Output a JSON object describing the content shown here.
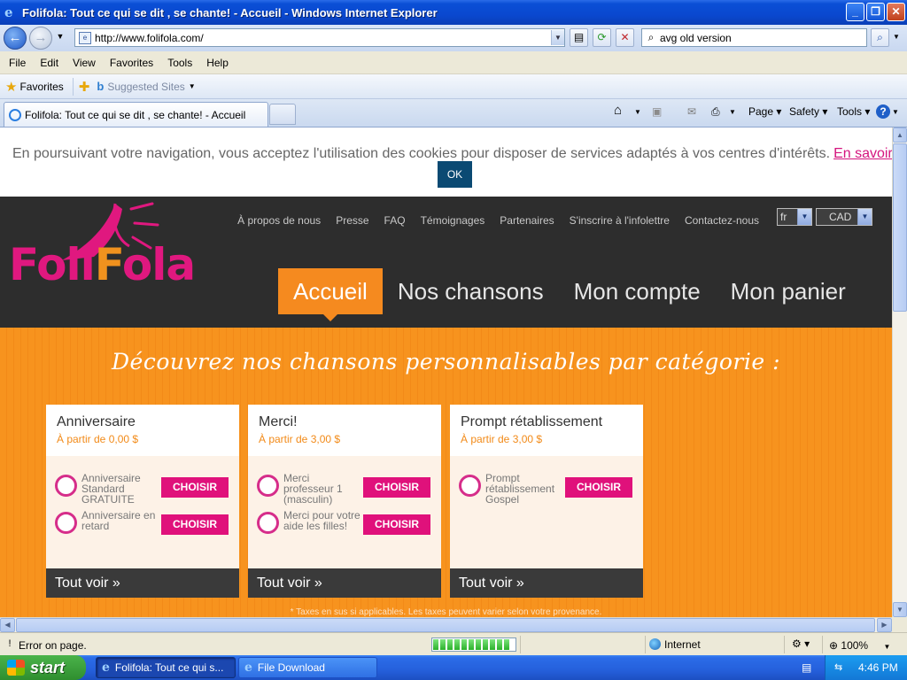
{
  "window": {
    "title": "Folifola: Tout ce qui se dit , se chante! - Accueil - Windows Internet Explorer"
  },
  "browser": {
    "address": "http://www.folifola.com/",
    "search_value": "avg old version",
    "menu": [
      "File",
      "Edit",
      "View",
      "Favorites",
      "Tools",
      "Help"
    ],
    "favorites_label": "Favorites",
    "suggested_sites": "Suggested Sites",
    "tab_title": "Folifola: Tout ce qui se dit , se chante! - Accueil",
    "commands": {
      "page": "Page",
      "safety": "Safety",
      "tools": "Tools"
    }
  },
  "cookie_banner": {
    "message": "En poursuivant votre navigation, vous acceptez l'utilisation des cookies pour disposer de services adaptés à vos centres d'intérêts.",
    "link": "En savoir plu",
    "ok": "OK"
  },
  "site": {
    "logo_text": "FoliFola",
    "top_links": [
      "À propos de nous",
      "Presse",
      "FAQ",
      "Témoignages",
      "Partenaires",
      "S'inscrire à l'infolettre",
      "Contactez-nous"
    ],
    "language": "fr",
    "currency": "CAD",
    "nav": [
      "Accueil",
      "Nos chansons",
      "Mon compte",
      "Mon panier"
    ],
    "tagline": "Découvrez nos chansons personnalisables par catégorie :",
    "tax_note": "* Taxes en sus si applicables. Les taxes peuvent varier selon votre provenance.",
    "choose_label": "CHOISIR",
    "see_all_label": "Tout voir »"
  },
  "categories": [
    {
      "name": "Anniversaire",
      "price": "À partir de 0,00 $",
      "songs": [
        "Anniversaire Standard GRATUITE",
        "Anniversaire en retard"
      ]
    },
    {
      "name": "Merci!",
      "price": "À partir de 3,00 $",
      "songs": [
        "Merci professeur 1 (masculin)",
        "Merci pour votre aide les filles!"
      ]
    },
    {
      "name": "Prompt rétablissement",
      "price": "À partir de 3,00 $",
      "songs": [
        "Prompt rétablissement Gospel"
      ]
    }
  ],
  "status": {
    "text": "Error on page.",
    "zone": "Internet",
    "zoom": "100%"
  },
  "taskbar": {
    "start": "start",
    "items": [
      "Folifola: Tout ce qui s...",
      "File Download"
    ],
    "clock": "4:46 PM"
  }
}
